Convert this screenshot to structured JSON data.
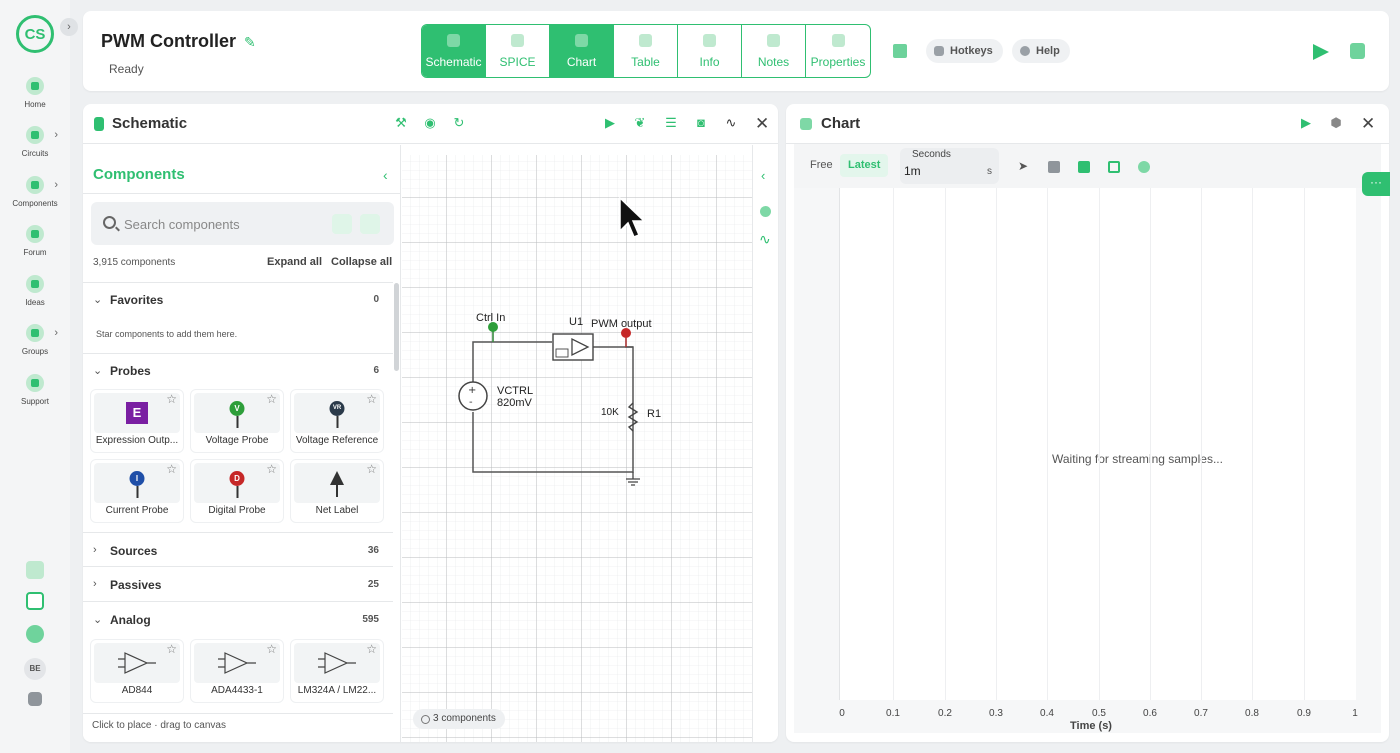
{
  "rail": {
    "logo_text": "CS",
    "items": [
      {
        "label": "Home",
        "icon": "home-icon"
      },
      {
        "label": "Circuits",
        "icon": "circuits-icon"
      },
      {
        "label": "Components",
        "icon": "components-icon"
      },
      {
        "label": "Forum",
        "icon": "forum-icon"
      },
      {
        "label": "Ideas",
        "icon": "ideas-icon"
      },
      {
        "label": "Groups",
        "icon": "groups-icon"
      },
      {
        "label": "Support",
        "icon": "support-icon"
      }
    ],
    "user_initials": "BE"
  },
  "header": {
    "title": "PWM Controller",
    "status": "Ready",
    "tabs": [
      {
        "label": "Schematic"
      },
      {
        "label": "SPICE"
      },
      {
        "label": "Chart"
      },
      {
        "label": "Table"
      },
      {
        "label": "Info"
      },
      {
        "label": "Notes"
      },
      {
        "label": "Properties"
      }
    ],
    "hotkeys_label": "Hotkeys",
    "help_label": "Help"
  },
  "schematic": {
    "title": "Schematic",
    "components": {
      "title": "Components",
      "search_placeholder": "Search components",
      "count_text": "3,915 components",
      "expand_all": "Expand all",
      "collapse_all": "Collapse all",
      "categories": [
        {
          "name": "Favorites",
          "count": "0",
          "empty_text": "Star components to add them here."
        },
        {
          "name": "Probes",
          "count": "6"
        },
        {
          "name": "Sources",
          "count": "36"
        },
        {
          "name": "Passives",
          "count": "25"
        },
        {
          "name": "Analog",
          "count": "595"
        }
      ],
      "probes": [
        {
          "label": "Expression Outp...",
          "glyph": "E"
        },
        {
          "label": "Voltage Probe",
          "glyph": "V"
        },
        {
          "label": "Voltage Reference",
          "glyph": "VR"
        },
        {
          "label": "Current Probe",
          "glyph": "I"
        },
        {
          "label": "Digital Probe",
          "glyph": "D"
        },
        {
          "label": "Net Label",
          "glyph": ""
        }
      ],
      "analog": [
        {
          "label": "AD844"
        },
        {
          "label": "ADA4433-1"
        },
        {
          "label": "LM324A / LM22..."
        }
      ],
      "footer_hint": "Click to place · drag to canvas"
    },
    "canvas": {
      "labels": {
        "ctrl_in": "Ctrl In",
        "u1": "U1",
        "pwm_output": "PWM output",
        "vctrl": "VCTRL",
        "vctrl_value": "820mV",
        "r_value": "10K",
        "r_name": "R1"
      },
      "component_count": "3 components"
    }
  },
  "chart": {
    "title": "Chart",
    "mode_free": "Free",
    "mode_latest": "Latest",
    "seconds_label": "Seconds",
    "seconds_value": "1m",
    "seconds_unit": "s",
    "waiting_text": "Waiting for streaming samples...",
    "float_button": "···"
  },
  "chart_data": {
    "type": "line",
    "title": "",
    "xlabel": "Time (s)",
    "ylabel": "",
    "x_ticks": [
      "0",
      "0.1",
      "0.2",
      "0.3",
      "0.4",
      "0.5",
      "0.6",
      "0.7",
      "0.8",
      "0.9",
      "1"
    ],
    "xlim": [
      0,
      1
    ],
    "series": [],
    "grid": true
  },
  "colors": {
    "accent": "#2fbf71",
    "probe_v": "#2e9e3a",
    "probe_vr": "#2b3a4a",
    "probe_i": "#1f4fa8",
    "probe_d": "#c62828",
    "expression": "#7a1fa2"
  }
}
